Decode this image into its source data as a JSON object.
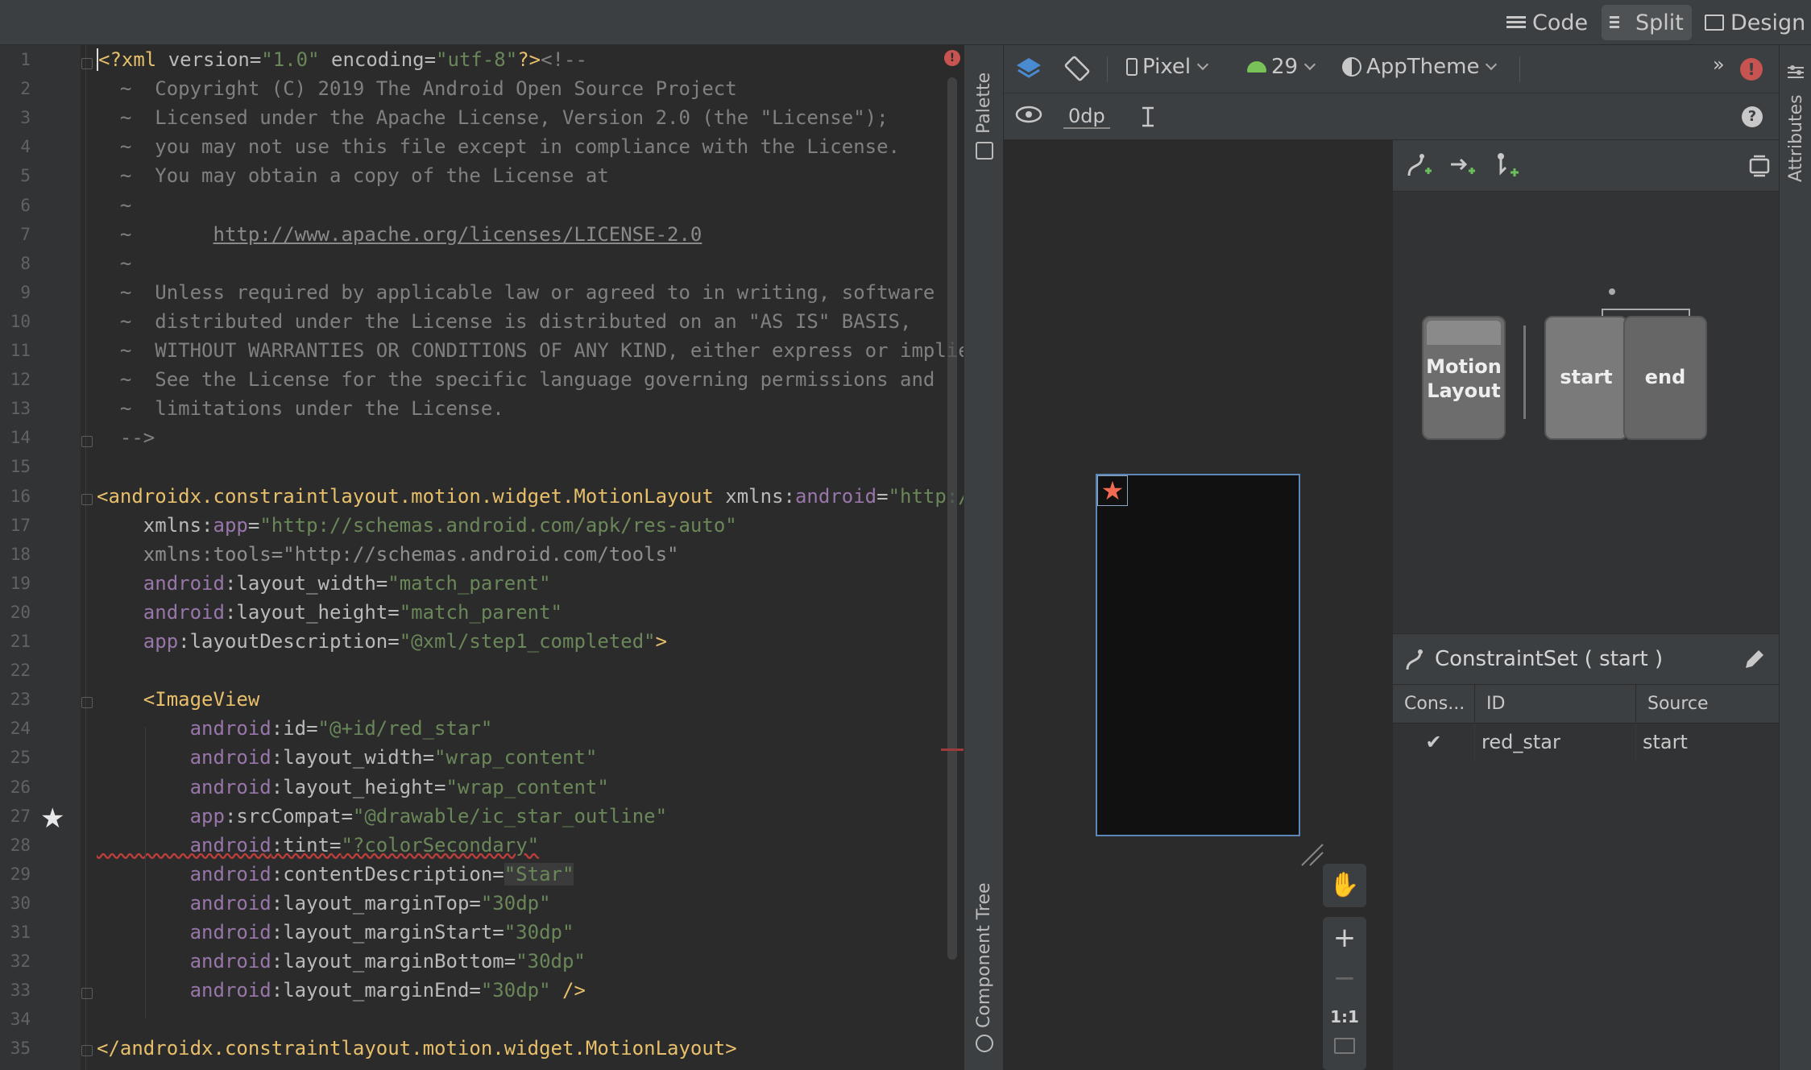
{
  "toolbar_modes": [
    {
      "label": "Code",
      "active": false
    },
    {
      "label": "Split",
      "active": true
    },
    {
      "label": "Design",
      "active": false
    }
  ],
  "editor": {
    "line_numbers": [
      "1",
      "2",
      "3",
      "4",
      "5",
      "6",
      "7",
      "8",
      "9",
      "10",
      "11",
      "12",
      "13",
      "14",
      "15",
      "16",
      "17",
      "18",
      "19",
      "20",
      "21",
      "22",
      "23",
      "24",
      "25",
      "26",
      "27",
      "28",
      "29",
      "30",
      "31",
      "32",
      "33",
      "34",
      "35"
    ],
    "lines": [
      [
        [
          "t-cursor t-tag",
          "<?xml "
        ],
        [
          "t-attr",
          "version="
        ],
        [
          "t-str",
          "\"1.0\""
        ],
        [
          "t-attr",
          " encoding="
        ],
        [
          "t-str",
          "\"utf-8\""
        ],
        [
          "t-tag",
          "?>"
        ],
        [
          "t-com",
          "<!--"
        ]
      ],
      [
        [
          "t-com",
          "  ~  Copyright (C) 2019 The Android Open Source Project"
        ]
      ],
      [
        [
          "t-com",
          "  ~  Licensed under the Apache License, Version 2.0 (the \"License\");"
        ]
      ],
      [
        [
          "t-com",
          "  ~  you may not use this file except in compliance with the License."
        ]
      ],
      [
        [
          "t-com",
          "  ~  You may obtain a copy of the License at"
        ]
      ],
      [
        [
          "t-com",
          "  ~"
        ]
      ],
      [
        [
          "t-com",
          "  ~       "
        ],
        [
          "t-link",
          "http://www.apache.org/licenses/LICENSE-2.0"
        ]
      ],
      [
        [
          "t-com",
          "  ~"
        ]
      ],
      [
        [
          "t-com",
          "  ~  Unless required by applicable law or agreed to in writing, software"
        ]
      ],
      [
        [
          "t-com",
          "  ~  distributed under the License is distributed on an \"AS IS\" BASIS,"
        ]
      ],
      [
        [
          "t-com",
          "  ~  WITHOUT WARRANTIES OR CONDITIONS OF ANY KIND, either express or implied"
        ]
      ],
      [
        [
          "t-com",
          "  ~  See the License for the specific language governing permissions and"
        ]
      ],
      [
        [
          "t-com",
          "  ~  limitations under the License."
        ]
      ],
      [
        [
          "t-com",
          "  -->"
        ]
      ],
      [
        [
          "",
          ""
        ]
      ],
      [
        [
          "t-tag",
          "<androidx.constraintlayout.motion.widget.MotionLayout "
        ],
        [
          "t-attr",
          "xmlns:"
        ],
        [
          "t-ns",
          "android"
        ],
        [
          "t-attr",
          "="
        ],
        [
          "t-str",
          "\"http://s"
        ]
      ],
      [
        [
          "t-attr",
          "    xmlns:"
        ],
        [
          "t-ns",
          "app"
        ],
        [
          "t-attr",
          "="
        ],
        [
          "t-str",
          "\"http://schemas.android.com/apk/res-auto\""
        ]
      ],
      [
        [
          "t-grey",
          "    xmlns:tools=\"http://schemas.android.com/tools\""
        ]
      ],
      [
        [
          "t-ns",
          "    android"
        ],
        [
          "t-attr",
          ":layout_width="
        ],
        [
          "t-str",
          "\"match_parent\""
        ]
      ],
      [
        [
          "t-ns",
          "    android"
        ],
        [
          "t-attr",
          ":layout_height="
        ],
        [
          "t-str",
          "\"match_parent\""
        ]
      ],
      [
        [
          "t-ns",
          "    app"
        ],
        [
          "t-attr",
          ":layoutDescription="
        ],
        [
          "t-str",
          "\"@xml/step1_completed\""
        ],
        [
          "t-tag",
          ">"
        ]
      ],
      [
        [
          "",
          ""
        ]
      ],
      [
        [
          "t-tag",
          "    <ImageView"
        ]
      ],
      [
        [
          "t-ns",
          "        android"
        ],
        [
          "t-attr",
          ":id="
        ],
        [
          "t-str",
          "\"@+id/red_star\""
        ]
      ],
      [
        [
          "t-ns",
          "        android"
        ],
        [
          "t-attr",
          ":layout_width="
        ],
        [
          "t-str",
          "\"wrap_content\""
        ]
      ],
      [
        [
          "t-ns",
          "        android"
        ],
        [
          "t-attr",
          ":layout_height="
        ],
        [
          "t-str",
          "\"wrap_content\""
        ]
      ],
      [
        [
          "t-ns",
          "        app"
        ],
        [
          "t-attr",
          ":srcCompat="
        ],
        [
          "t-str",
          "\"@drawable/ic_star_outline\""
        ]
      ],
      [
        [
          "t-ns t-squig",
          "        android"
        ],
        [
          "t-attr t-squig",
          ":tint="
        ],
        [
          "t-str t-squig",
          "\"?colorSecondary\""
        ]
      ],
      [
        [
          "t-ns",
          "        android"
        ],
        [
          "t-attr",
          ":contentDescription="
        ],
        [
          "t-str t-hl",
          "\"Star\""
        ]
      ],
      [
        [
          "t-ns",
          "        android"
        ],
        [
          "t-attr",
          ":layout_marginTop="
        ],
        [
          "t-str",
          "\"30dp\""
        ]
      ],
      [
        [
          "t-ns",
          "        android"
        ],
        [
          "t-attr",
          ":layout_marginStart="
        ],
        [
          "t-str",
          "\"30dp\""
        ]
      ],
      [
        [
          "t-ns",
          "        android"
        ],
        [
          "t-attr",
          ":layout_marginBottom="
        ],
        [
          "t-str",
          "\"30dp\""
        ]
      ],
      [
        [
          "t-ns",
          "        android"
        ],
        [
          "t-attr",
          ":layout_marginEnd="
        ],
        [
          "t-str",
          "\"30dp\""
        ],
        [
          "t-tag",
          " />"
        ]
      ],
      [
        [
          "",
          ""
        ]
      ],
      [
        [
          "t-tag",
          "</androidx.constraintlayout.motion.widget.MotionLayout>"
        ]
      ]
    ]
  },
  "palette_label": "Palette",
  "component_tree_label": "Component Tree",
  "attributes_label": "Attributes",
  "design_toolbar": {
    "device": "Pixel",
    "api": "29",
    "theme": "AppTheme",
    "margin": "0dp"
  },
  "motion_editor": {
    "nodes": {
      "layout": "Motion\nLayout",
      "start": "start",
      "end": "end"
    },
    "constraint_set_title": "ConstraintSet ( start )",
    "columns": [
      "Cons...",
      "ID",
      "Source"
    ],
    "rows": [
      {
        "check": "✔",
        "id": "red_star",
        "source": "start"
      }
    ]
  },
  "zoom": {
    "ratio_label": "1:1"
  }
}
